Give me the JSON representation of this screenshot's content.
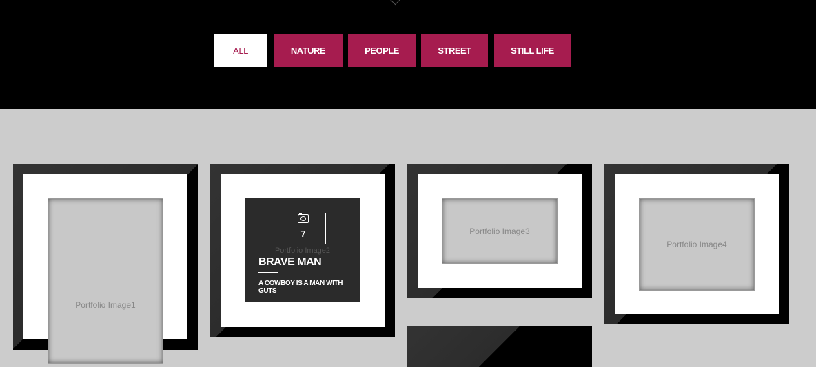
{
  "filters": [
    {
      "label": "ALL",
      "active": true
    },
    {
      "label": "NATURE",
      "active": false
    },
    {
      "label": "PEOPLE",
      "active": false
    },
    {
      "label": "STREET",
      "active": false
    },
    {
      "label": "STILL LIFE",
      "active": false
    }
  ],
  "portfolio": {
    "items": [
      {
        "alt": "Portfolio Image1"
      },
      {
        "alt": "Portfolio Image2",
        "count": "7",
        "title": "BRAVE MAN",
        "subtitle": "A COWBOY IS A MAN WITH GUTS",
        "icon": "camera-icon"
      },
      {
        "alt": "Portfolio Image3"
      },
      {
        "alt": "Portfolio Image4"
      }
    ]
  },
  "colors": {
    "accent": "#a61c4f",
    "header_bg": "#000000",
    "page_bg": "#cccccc"
  }
}
